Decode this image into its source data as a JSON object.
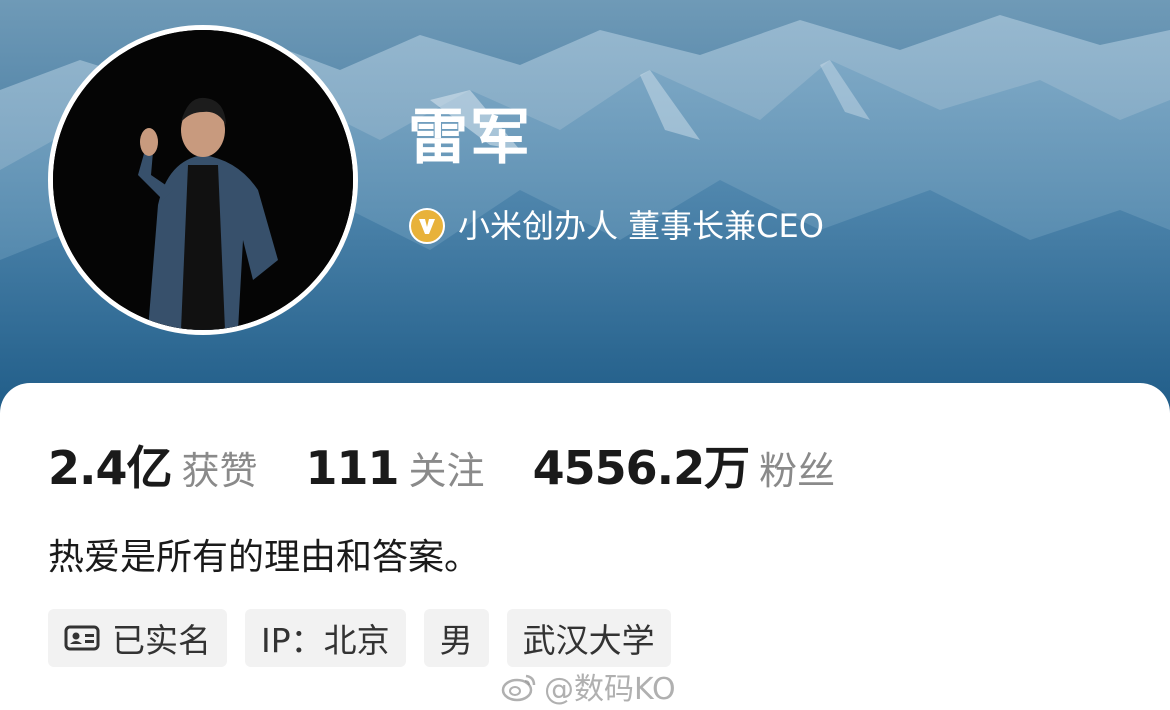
{
  "profile": {
    "name": "雷军",
    "verified_text": "小米创办人 董事长兼CEO",
    "bio": "热爱是所有的理由和答案。"
  },
  "stats": [
    {
      "value": "2.4亿",
      "label": "获赞"
    },
    {
      "value": "111",
      "label": "关注"
    },
    {
      "value": "4556.2万",
      "label": "粉丝"
    }
  ],
  "tags": [
    {
      "label": "已实名",
      "icon": "id-card-icon"
    },
    {
      "label": "IP：北京"
    },
    {
      "label": "男"
    },
    {
      "label": "武汉大学"
    }
  ],
  "watermark": {
    "text": "@数码KO",
    "icon": "weibo-icon"
  },
  "colors": {
    "banner_top": "#6f9ab7",
    "banner_bottom": "#1f5b87",
    "verified_badge": "#e8b23a",
    "tag_background": "#f2f2f2",
    "stat_label": "#8a8a8a"
  }
}
